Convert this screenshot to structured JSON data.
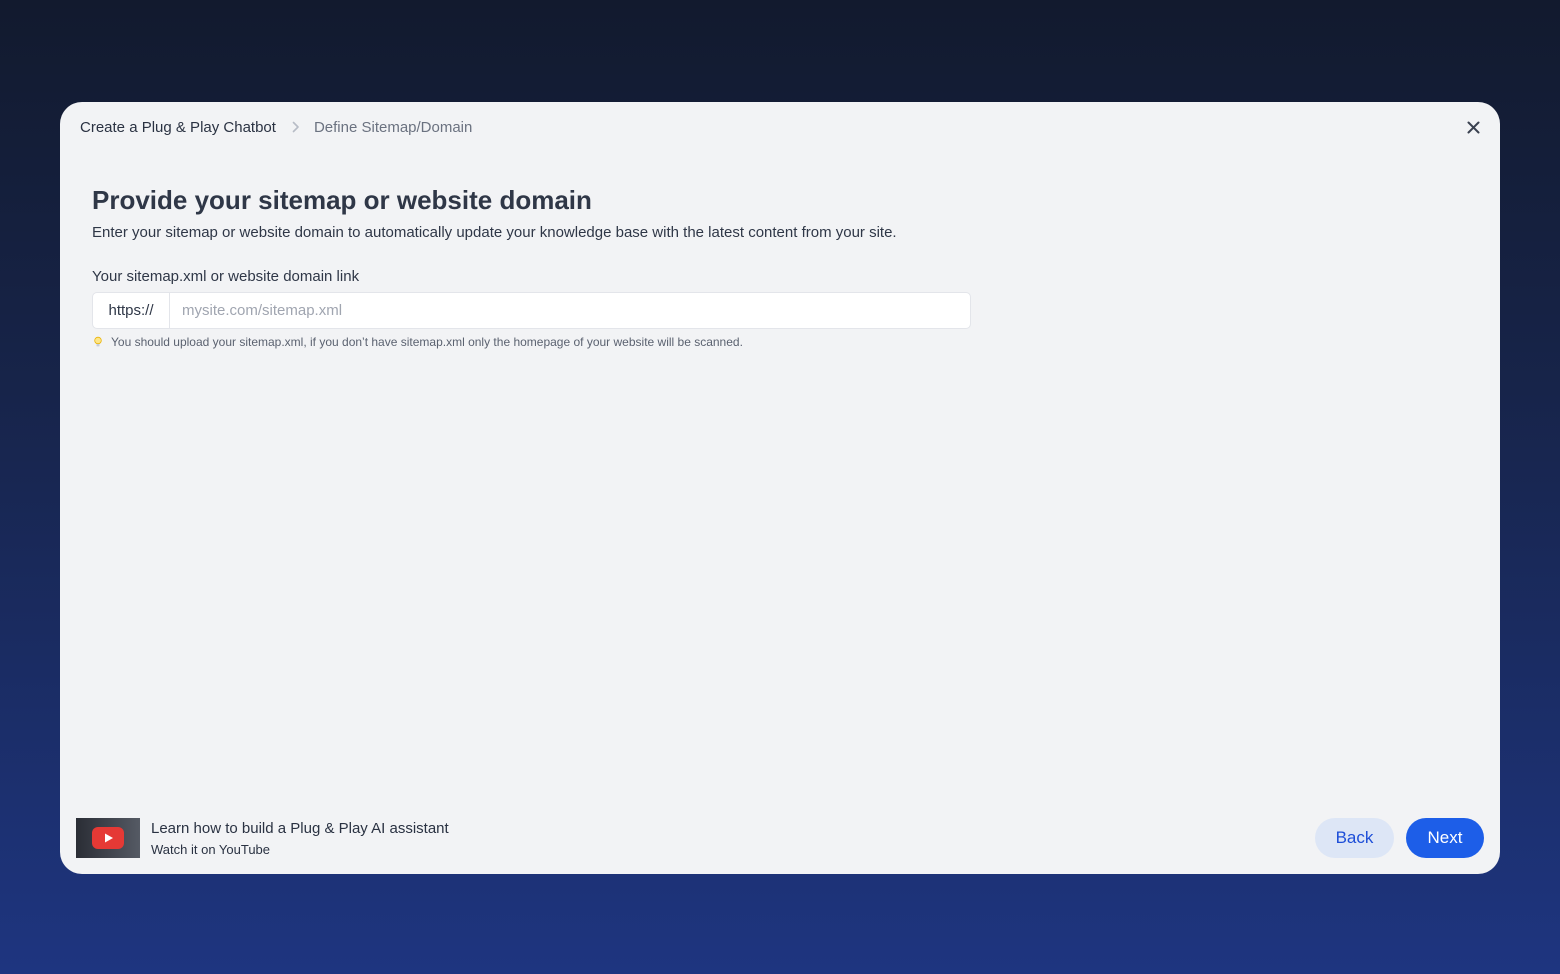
{
  "breadcrumb": {
    "root": "Create a Plug & Play Chatbot",
    "separator_icon": "chevron-right-icon",
    "current": "Define Sitemap/Domain"
  },
  "close_icon": "close-icon",
  "main": {
    "title": "Provide your sitemap or website domain",
    "subtitle": "Enter your sitemap or website domain to automatically update your knowledge base with the latest content from your site.",
    "field_label": "Your sitemap.xml or website domain link",
    "input": {
      "prefix": "https://",
      "value": "",
      "placeholder": "mysite.com/sitemap.xml"
    },
    "hint": {
      "icon": "lightbulb-icon",
      "text": "You should upload your sitemap.xml, if you don’t have sitemap.xml only the homepage of your website will be scanned."
    }
  },
  "footer": {
    "video": {
      "thumbnail_icon": "youtube-play-icon",
      "title": "Learn how to build a Plug & Play AI assistant",
      "subtitle": "Watch it on YouTube"
    },
    "back_label": "Back",
    "next_label": "Next"
  },
  "colors": {
    "primary": "#1d5ee8",
    "secondary_bg": "#dde6f6",
    "modal_bg": "#f2f3f5",
    "youtube_red": "#e53935"
  }
}
